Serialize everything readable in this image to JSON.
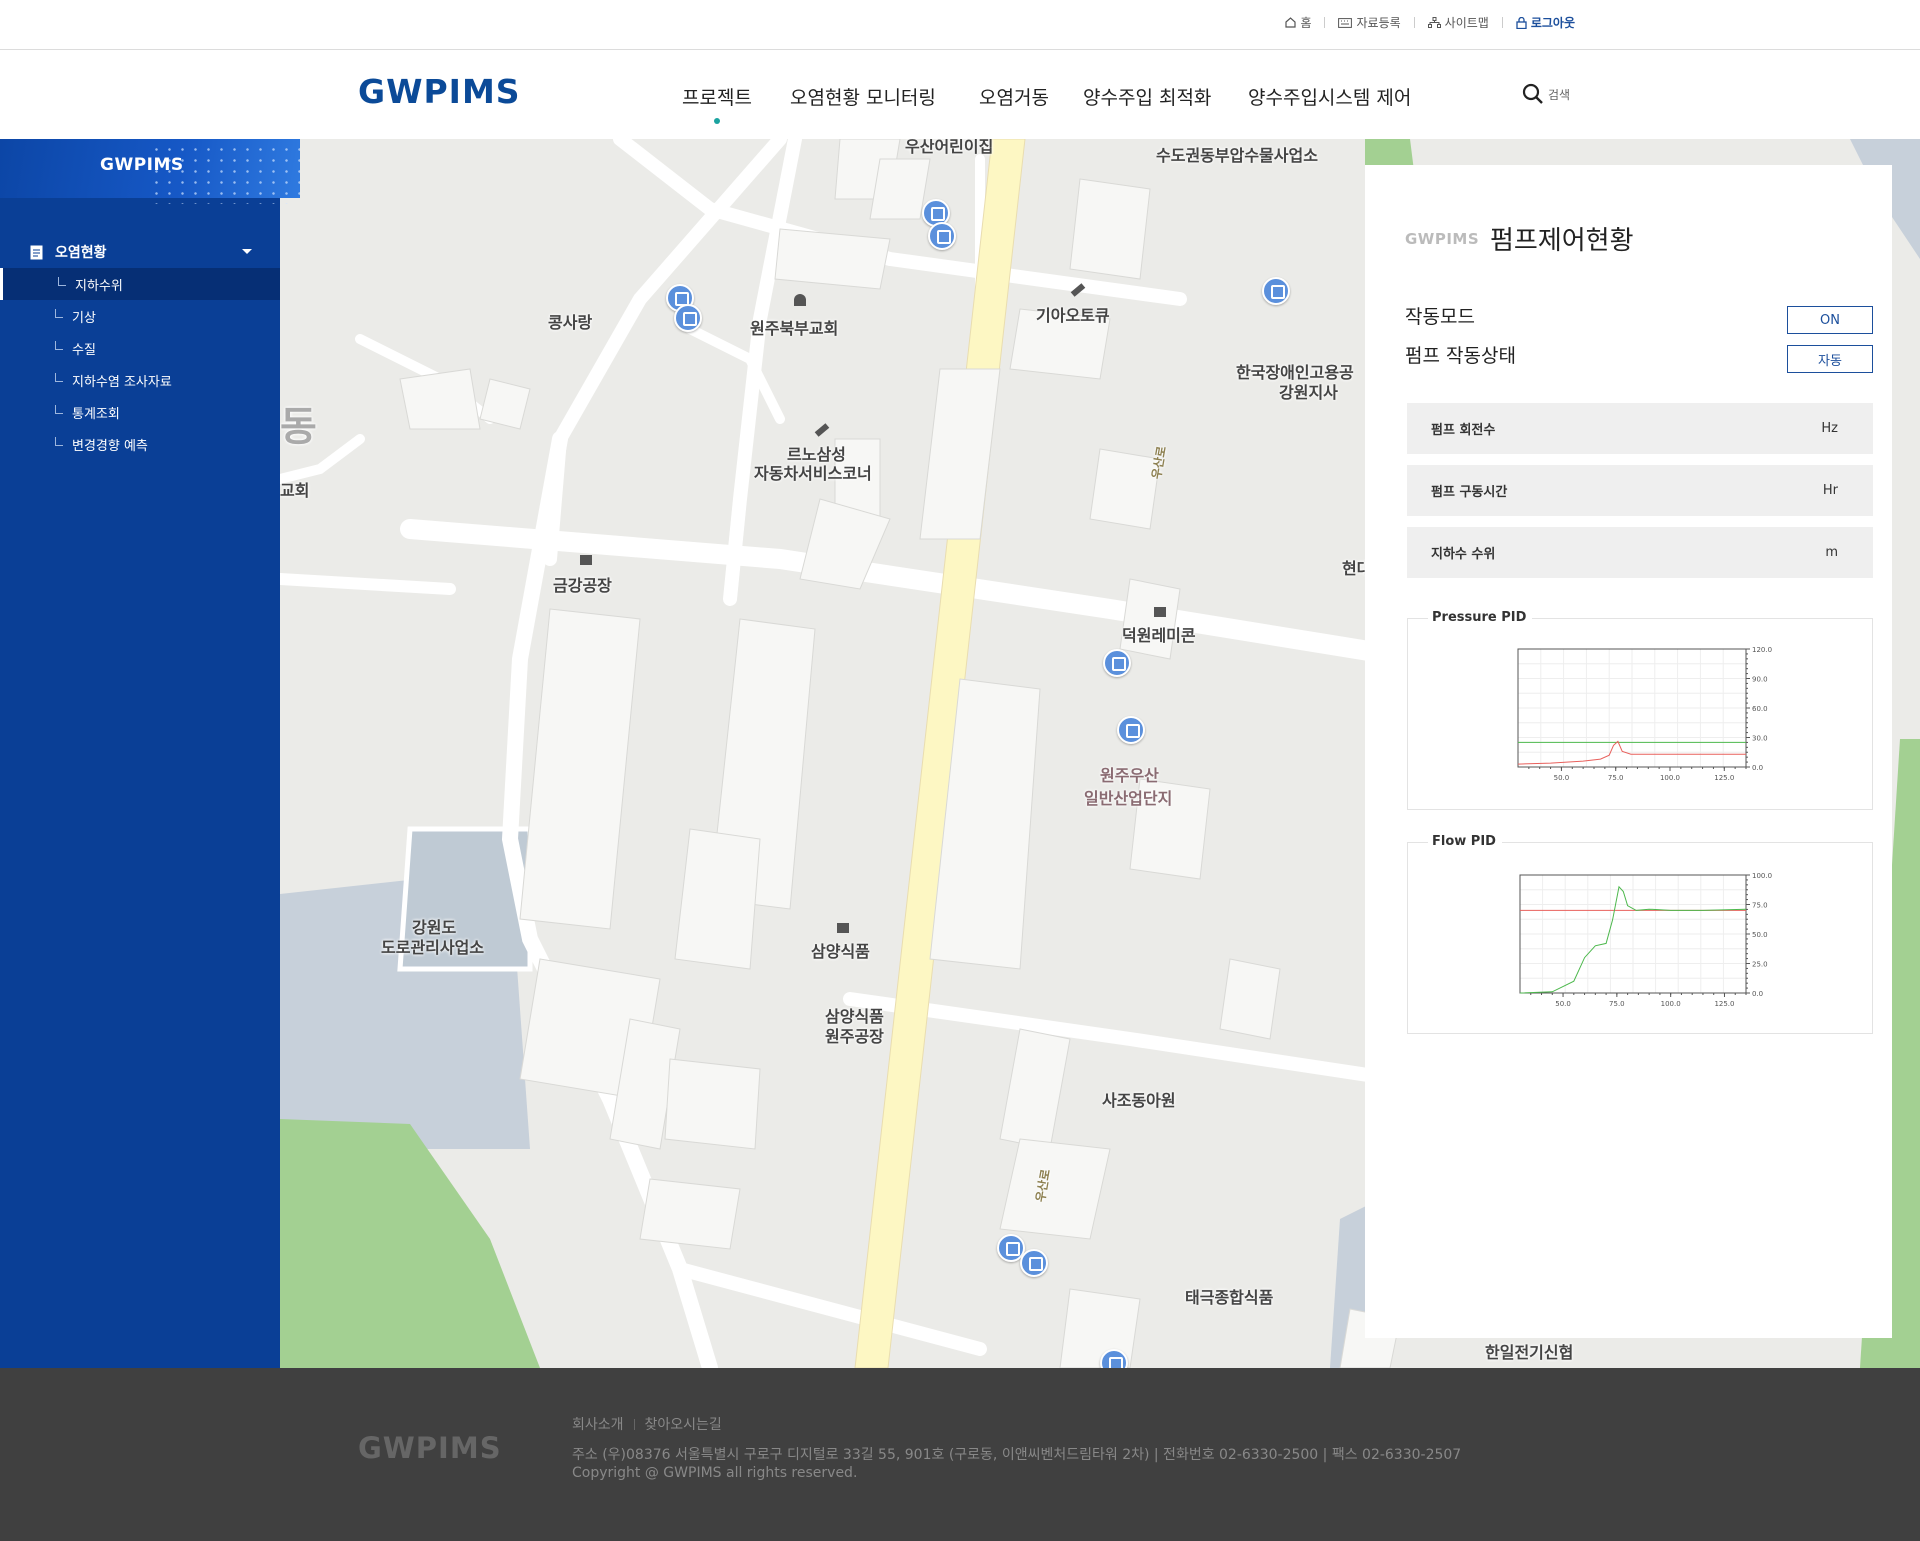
{
  "utility_nav": {
    "home": "홈",
    "data_register": "자료등록",
    "sitemap": "사이트맵",
    "logout": "로그아웃"
  },
  "brand": {
    "logo": "GWPIMS",
    "accent_color": "#0b4a98",
    "sidebar_color": "#0a3f96",
    "active_dot_color": "#1ba3a0"
  },
  "main_menu": [
    {
      "label": "프로젝트",
      "active": true
    },
    {
      "label": "오염현황 모니터링",
      "active": false
    },
    {
      "label": "오염거동",
      "active": false
    },
    {
      "label": "양수주입 최적화",
      "active": false
    },
    {
      "label": "양수주입시스템 제어",
      "active": false
    }
  ],
  "search": {
    "label": "검색",
    "icon": "search-icon"
  },
  "sidebar": {
    "logo": "GWPIMS",
    "section": {
      "label": "오염현황",
      "icon": "document-icon"
    },
    "items": [
      {
        "label": "지하수위",
        "active": true
      },
      {
        "label": "기상",
        "active": false
      },
      {
        "label": "수질",
        "active": false
      },
      {
        "label": "지하수염 조사자료",
        "active": false
      },
      {
        "label": "통계조회",
        "active": false
      },
      {
        "label": "변경경향 예측",
        "active": false
      }
    ]
  },
  "map": {
    "labels": {
      "l1": "우산어린이집",
      "l2": "수도권동부압수물사업소",
      "l3": "콩사랑",
      "l4": "원주북부교회",
      "l5": "기아오토큐",
      "l6": "한국장애인고용공",
      "l6b": "강원지사",
      "l7": "르노삼성",
      "l7b": "자동차서비스코너",
      "l8": "금강공장",
      "l9": "덕원레미콘",
      "l10": "현대",
      "l11": "원주우산",
      "l11b": "일반산업단지",
      "l12": "강원도",
      "l12b": "도로관리사업소",
      "l13": "삼양식품",
      "l14": "삼양식품",
      "l14b": "원주공장",
      "l15": "사조동아원",
      "l16": "태극종합식품",
      "l17": "한일전기신협",
      "l18": "교회",
      "l19": "동",
      "road1": "우산로",
      "road2": "우산로"
    }
  },
  "panel": {
    "brand": "GWPIMS",
    "title": "펌프제어현황",
    "mode_label": "작동모드",
    "mode_value": "ON",
    "state_label": "펌프 작동상태",
    "state_value": "자동",
    "stats": [
      {
        "label": "펌프 회전수",
        "unit": "Hz"
      },
      {
        "label": "펌프 구동시간",
        "unit": "Hr"
      },
      {
        "label": "지하수 수위",
        "unit": "m"
      }
    ]
  },
  "chart_data": [
    {
      "type": "line",
      "title": "Pressure PID",
      "x_ticks": [
        "50.0",
        "75.0",
        "100.0",
        "125.0"
      ],
      "y_ticks": [
        "120.0",
        "90.0",
        "60.0",
        "30.0",
        "0.0"
      ],
      "xlim": [
        30,
        135
      ],
      "ylim": [
        0,
        120
      ],
      "series": [
        {
          "color": "#4cb84c",
          "x": [
            30,
            135
          ],
          "y": [
            25,
            25
          ]
        },
        {
          "color": "#e8605c",
          "x": [
            30,
            45,
            60,
            68,
            72,
            74,
            76,
            78,
            82,
            95,
            110,
            135
          ],
          "y": [
            3,
            4,
            6,
            8,
            12,
            22,
            26,
            16,
            13,
            13,
            13,
            13
          ]
        }
      ]
    },
    {
      "type": "line",
      "title": "Flow PID",
      "x_ticks": [
        "50.0",
        "75.0",
        "100.0",
        "125.0"
      ],
      "y_ticks": [
        "100.0",
        "75.0",
        "50.0",
        "25.0",
        "0.0"
      ],
      "xlim": [
        30,
        135
      ],
      "ylim": [
        0,
        100
      ],
      "series": [
        {
          "color": "#e8605c",
          "x": [
            30,
            135
          ],
          "y": [
            70,
            70
          ]
        },
        {
          "color": "#4cb84c",
          "x": [
            30,
            45,
            55,
            60,
            65,
            70,
            73,
            76,
            78,
            80,
            84,
            90,
            100,
            115,
            135
          ],
          "y": [
            0,
            1,
            10,
            30,
            40,
            42,
            62,
            90,
            86,
            74,
            70,
            71,
            70,
            70,
            71
          ]
        }
      ]
    }
  ],
  "footer": {
    "logo": "GWPIMS",
    "link1": "회사소개",
    "link2": "찾아오시는길",
    "address": "주소 (우)08376 서울특별시 구로구 디지털로 33길 55, 901호 (구로동, 이앤씨벤처드림타워 2차)  |  전화번호 02-6330-2500  |  팩스 02-6330-2507",
    "copyright": "Copyright @ GWPIMS all rights reserved."
  }
}
